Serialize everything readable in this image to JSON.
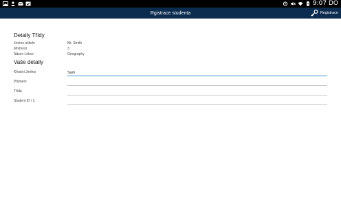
{
  "status_bar": {
    "time": "9:07 DO",
    "left_icons": [
      "image-icon",
      "person-icon",
      "mail-icon",
      "check-icon"
    ],
    "right_icons": [
      "settings-icon",
      "mute-icon",
      "wifi-icon",
      "battery-charging-icon"
    ]
  },
  "app_bar": {
    "title": "Rgistrace studenta",
    "action_label": "Registrace",
    "action_icon": "key-icon",
    "color": "#0b2c4f"
  },
  "class_details": {
    "title": "Detaily Třídy",
    "rows": [
      {
        "label": "Jméno učitele",
        "value": "Mr. Smith"
      },
      {
        "label": "Místnost",
        "value": "3"
      },
      {
        "label": "Název Lekce",
        "value": "Geography"
      }
    ]
  },
  "your_details": {
    "title": "Vaše detaily",
    "fields": [
      {
        "label": "Křestní Jméno",
        "value": "Sam"
      },
      {
        "label": "Příjmení",
        "value": ""
      },
      {
        "label": "Třída",
        "value": ""
      },
      {
        "label": "Student ID / č.",
        "value": ""
      }
    ]
  },
  "colors": {
    "accent": "#3a8fd6"
  }
}
